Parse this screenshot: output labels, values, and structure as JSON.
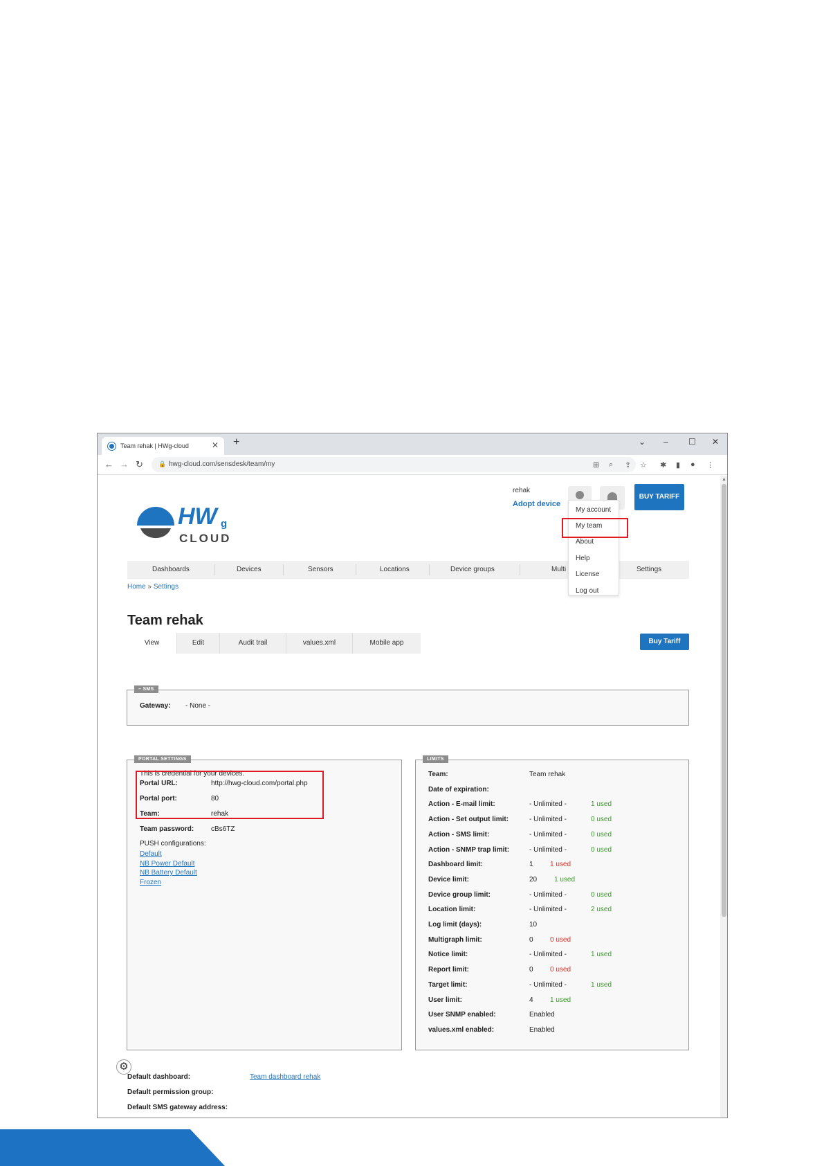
{
  "browser": {
    "tab_title": "Team rehak | HWg-cloud",
    "tab_close": "✕",
    "new_tab": "+",
    "url": "hwg-cloud.com/sensdesk/team/my",
    "window_controls": {
      "dropdown": "⌄",
      "minimize": "–",
      "maximize": "☐",
      "close": "✕"
    }
  },
  "header": {
    "logo_alt": "HWg CLOUD",
    "logo_text_main": "HW",
    "logo_text_sub": "g",
    "logo_text_cloud": "CLOUD",
    "user_name": "rehak",
    "adopt_device": "Adopt device",
    "buy_tariff": "BUY TARIFF"
  },
  "user_menu": {
    "items": [
      "My account",
      "My team",
      "About",
      "Help",
      "License",
      "Log out"
    ]
  },
  "main_nav": {
    "items": [
      "Dashboards",
      "Devices",
      "Sensors",
      "Locations",
      "Device groups",
      "Multi",
      "Settings"
    ]
  },
  "breadcrumb": {
    "home": "Home",
    "sep": "»",
    "current": "Settings"
  },
  "page": {
    "title": "Team rehak",
    "subtabs": [
      "View",
      "Edit",
      "Audit trail",
      "values.xml",
      "Mobile app"
    ],
    "buy_tariff": "Buy Tariff"
  },
  "sms": {
    "legend": "– SMS",
    "gateway_label": "Gateway:",
    "gateway_value": "- None -"
  },
  "portal": {
    "legend": "PORTAL SETTINGS",
    "intro": "This is credential for your devices.",
    "rows": [
      {
        "label": "Portal URL:",
        "value": "http://hwg-cloud.com/portal.php"
      },
      {
        "label": "Portal port:",
        "value": "80"
      },
      {
        "label": "Team:",
        "value": "rehak"
      },
      {
        "label": "Team password:",
        "value": "cBs6TZ"
      }
    ],
    "push_label": "PUSH configurations:",
    "push_links": [
      "Default",
      "NB Power Default",
      "NB Battery Default",
      "Frozen"
    ]
  },
  "limits": {
    "legend": "LIMITS",
    "rows": [
      {
        "label": "Team:",
        "value": "Team rehak",
        "used": ""
      },
      {
        "label": "Date of expiration:",
        "value": "",
        "used": ""
      },
      {
        "label": "Action - E-mail limit:",
        "value": "- Unlimited -",
        "used": "1 used"
      },
      {
        "label": "Action - Set output limit:",
        "value": "- Unlimited -",
        "used": "0 used"
      },
      {
        "label": "Action - SMS limit:",
        "value": "- Unlimited -",
        "used": "0 used"
      },
      {
        "label": "Action - SNMP trap limit:",
        "value": "- Unlimited -",
        "used": "0 used"
      },
      {
        "label": "Dashboard limit:",
        "value": "1",
        "used": "1 used"
      },
      {
        "label": "Device limit:",
        "value": "20",
        "used": "1 used"
      },
      {
        "label": "Device group limit:",
        "value": "- Unlimited -",
        "used": "0 used"
      },
      {
        "label": "Location limit:",
        "value": "- Unlimited -",
        "used": "2 used"
      },
      {
        "label": "Log limit (days):",
        "value": "10",
        "used": ""
      },
      {
        "label": "Multigraph limit:",
        "value": "0",
        "used": "0 used"
      },
      {
        "label": "Notice limit:",
        "value": "- Unlimited -",
        "used": "1 used"
      },
      {
        "label": "Report limit:",
        "value": "0",
        "used": "0 used"
      },
      {
        "label": "Target limit:",
        "value": "- Unlimited -",
        "used": "1 used"
      },
      {
        "label": "User limit:",
        "value": "4",
        "used": "1 used"
      },
      {
        "label": "User SNMP enabled:",
        "value": "Enabled",
        "used": ""
      },
      {
        "label": "values.xml enabled:",
        "value": "Enabled",
        "used": ""
      }
    ]
  },
  "bottom": {
    "default_dashboard_label": "Default dashboard:",
    "default_dashboard_value": "Team dashboard rehak",
    "default_permission_label": "Default permission group:",
    "default_sms_label": "Default SMS gateway address:"
  },
  "colors": {
    "accent": "#1f74bf",
    "highlight": "#e01a22",
    "used_ok": "#3a9a2a",
    "used_full": "#d9342b",
    "footer_blue": "#1e72c4"
  }
}
